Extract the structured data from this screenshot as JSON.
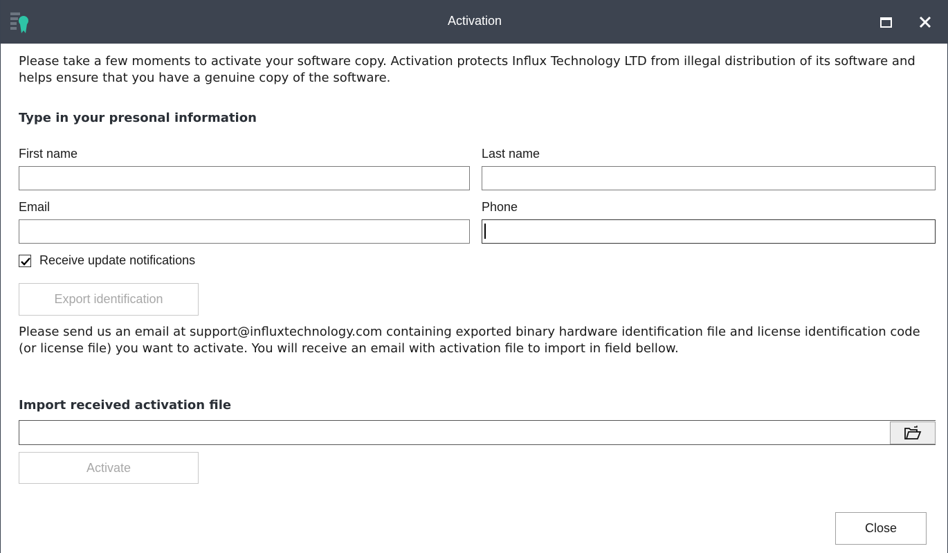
{
  "window": {
    "title": "Activation",
    "accent_color": "#3d4450",
    "icon": "certificate-icon"
  },
  "intro": {
    "text": "Please take a few moments to activate your software copy. Activation protects Influx Technology LTD from illegal distribution of its software and helps ensure that you have a genuine copy of the software."
  },
  "personal": {
    "heading": "Type in your presonal information",
    "first_name": {
      "label": "First name",
      "value": ""
    },
    "last_name": {
      "label": "Last name",
      "value": ""
    },
    "email": {
      "label": "Email",
      "value": ""
    },
    "phone": {
      "label": "Phone",
      "value": ""
    }
  },
  "notifications": {
    "label": "Receive update notifications",
    "checked": true
  },
  "export": {
    "label": "Export identification",
    "enabled": false
  },
  "instructions": {
    "text": "Please send us an email at support@influxtechnology.com containing exported binary hardware identification file and license identification code (or license file) you want to activate. You will receive an email with activation file to import in field bellow."
  },
  "import": {
    "heading": "Import received activation file",
    "value": "",
    "browse_icon": "folder-open-icon"
  },
  "activate": {
    "label": "Activate",
    "enabled": false
  },
  "close": {
    "label": "Close"
  }
}
